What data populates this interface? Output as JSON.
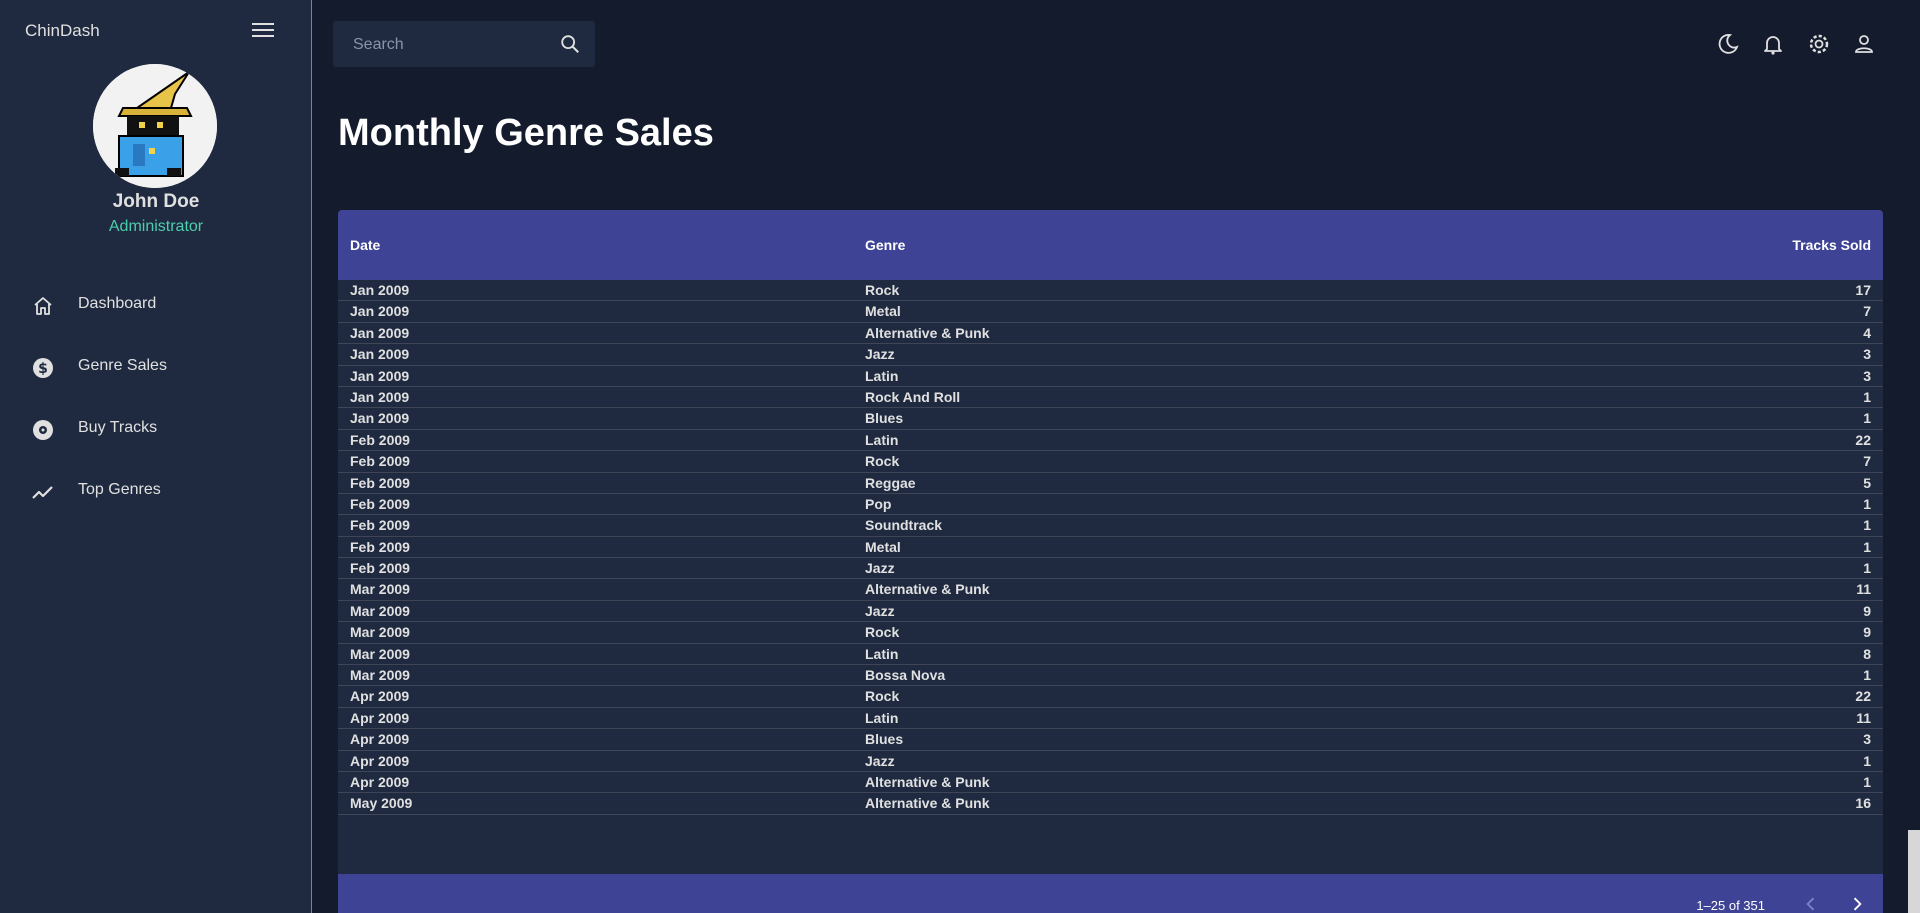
{
  "app": {
    "title": "ChinDash"
  },
  "user": {
    "name": "John Doe",
    "role": "Administrator"
  },
  "nav": [
    {
      "label": "Dashboard",
      "icon": "home-icon"
    },
    {
      "label": "Genre Sales",
      "icon": "dollar-icon"
    },
    {
      "label": "Buy Tracks",
      "icon": "disc-icon"
    },
    {
      "label": "Top Genres",
      "icon": "trending-icon"
    }
  ],
  "search": {
    "placeholder": "Search"
  },
  "page": {
    "title": "Monthly Genre Sales"
  },
  "table": {
    "columns": [
      "Date",
      "Genre",
      "Tracks Sold"
    ],
    "rows": [
      [
        "Jan 2009",
        "Rock",
        "17"
      ],
      [
        "Jan 2009",
        "Metal",
        "7"
      ],
      [
        "Jan 2009",
        "Alternative & Punk",
        "4"
      ],
      [
        "Jan 2009",
        "Jazz",
        "3"
      ],
      [
        "Jan 2009",
        "Latin",
        "3"
      ],
      [
        "Jan 2009",
        "Rock And Roll",
        "1"
      ],
      [
        "Jan 2009",
        "Blues",
        "1"
      ],
      [
        "Feb 2009",
        "Latin",
        "22"
      ],
      [
        "Feb 2009",
        "Rock",
        "7"
      ],
      [
        "Feb 2009",
        "Reggae",
        "5"
      ],
      [
        "Feb 2009",
        "Pop",
        "1"
      ],
      [
        "Feb 2009",
        "Soundtrack",
        "1"
      ],
      [
        "Feb 2009",
        "Metal",
        "1"
      ],
      [
        "Feb 2009",
        "Jazz",
        "1"
      ],
      [
        "Mar 2009",
        "Alternative & Punk",
        "11"
      ],
      [
        "Mar 2009",
        "Jazz",
        "9"
      ],
      [
        "Mar 2009",
        "Rock",
        "9"
      ],
      [
        "Mar 2009",
        "Latin",
        "8"
      ],
      [
        "Mar 2009",
        "Bossa Nova",
        "1"
      ],
      [
        "Apr 2009",
        "Rock",
        "22"
      ],
      [
        "Apr 2009",
        "Latin",
        "11"
      ],
      [
        "Apr 2009",
        "Blues",
        "3"
      ],
      [
        "Apr 2009",
        "Jazz",
        "1"
      ],
      [
        "Apr 2009",
        "Alternative & Punk",
        "1"
      ],
      [
        "May 2009",
        "Alternative & Punk",
        "16"
      ]
    ],
    "pagination": "1–25 of 351"
  },
  "colors": {
    "background": "#141b2d",
    "sidebar": "#1f2a40",
    "accent_green": "#4cceac",
    "table_header": "#3e4396"
  }
}
